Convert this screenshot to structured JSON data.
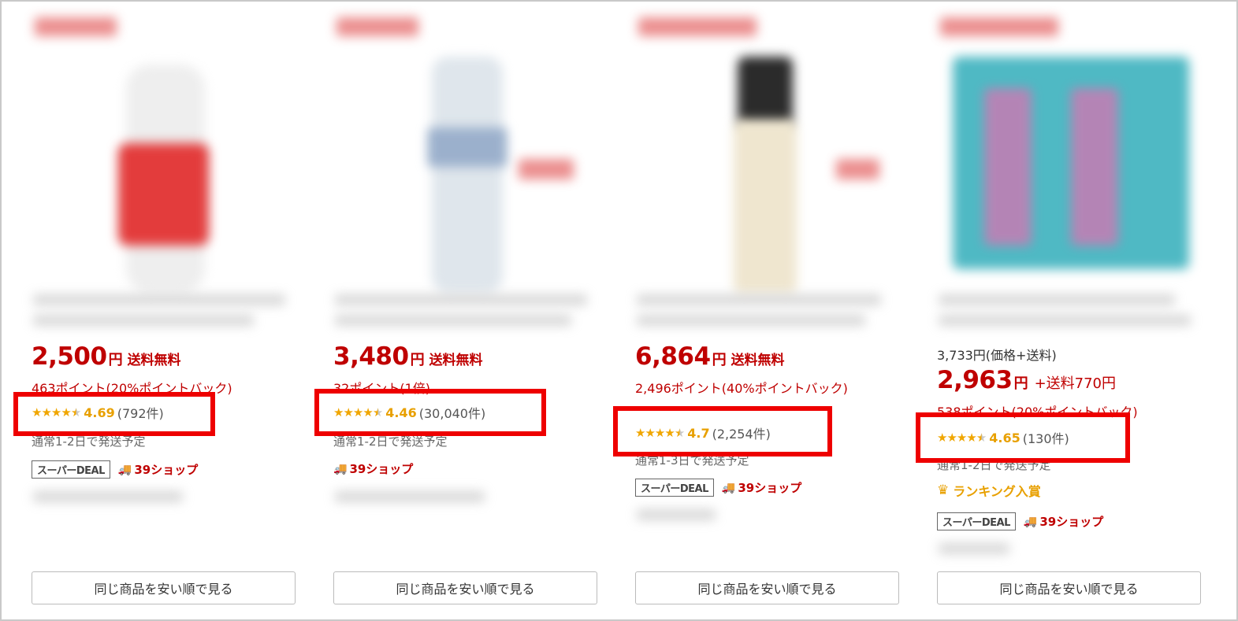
{
  "products": [
    {
      "price": "2,500",
      "yen": "円",
      "shipping": "送料無料",
      "points": "463ポイント(20%ポイントバック)",
      "rating": "4.69",
      "review_count": "(792件)",
      "ship_date": "通常1-2日で発送予定",
      "deal_tag": "スーパーDEAL",
      "shop39": "39ショップ",
      "button_label": "同じ商品を安い順で見る"
    },
    {
      "price": "3,480",
      "yen": "円",
      "shipping": "送料無料",
      "points": "32ポイント(1倍)",
      "rating": "4.46",
      "review_count": "(30,040件)",
      "ship_date": "通常1-2日で発送予定",
      "shop39": "39ショップ",
      "button_label": "同じ商品を安い順で見る"
    },
    {
      "price": "6,864",
      "yen": "円",
      "shipping": "送料無料",
      "points": "2,496ポイント(40%ポイントバック)",
      "rating": "4.7",
      "review_count": "(2,254件)",
      "ship_date": "通常1-3日で発送予定",
      "deal_tag": "スーパーDEAL",
      "shop39": "39ショップ",
      "button_label": "同じ商品を安い順で見る"
    },
    {
      "original_price": "3,733円(価格+送料)",
      "price": "2,963",
      "yen": "円",
      "shipping_fee": "+送料770円",
      "points": "538ポイント(20%ポイントバック)",
      "rating": "4.65",
      "review_count": "(130件)",
      "ship_date": "通常1-2日で発送予定",
      "ranking": "ランキング入賞",
      "deal_tag": "スーパーDEAL",
      "shop39": "39ショップ",
      "button_label": "同じ商品を安い順で見る"
    }
  ],
  "icons": {
    "star": "★",
    "truck": "🚚",
    "crown": "♛"
  },
  "colors": {
    "price_red": "#bf0000",
    "star_gold": "#f0a600",
    "highlight_red": "#ee0000"
  }
}
